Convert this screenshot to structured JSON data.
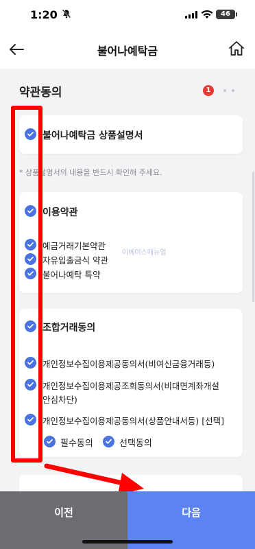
{
  "status_bar": {
    "time": "1:20",
    "battery": "46"
  },
  "header": {
    "title": "불어나예탁금"
  },
  "page": {
    "section_title": "약관동의",
    "step_current": "1"
  },
  "cards": {
    "product": {
      "title": "불어나예탁금 상품설명서",
      "notice": "* 상품설명서의 내용을 반드시 확인해 주세요."
    },
    "terms": {
      "title": "이용약관",
      "items": [
        "예금거래기본약관",
        "자유입출금식 약관",
        "불어나예탁 특약"
      ]
    },
    "combined": {
      "title": "조합거래동의",
      "items": [
        "개인정보수집이용제공동의서(비여신금융거래등)",
        "개인정보수집이용제공조회동의서(비대면계좌개설",
        "안심차단)",
        "개인정보수집이용제공동의서(상품안내서등) [선택]"
      ],
      "required_label": "필수동의",
      "optional_label": "선택동의"
    }
  },
  "watermark": "이베이스매뉴얼",
  "footer": {
    "prev_label": "이전",
    "next_label": "다음"
  },
  "colors": {
    "check": "#4a72e0",
    "next_button": "#5b84f2",
    "prev_button": "#6c6d72",
    "annotation": "#ff0000"
  }
}
